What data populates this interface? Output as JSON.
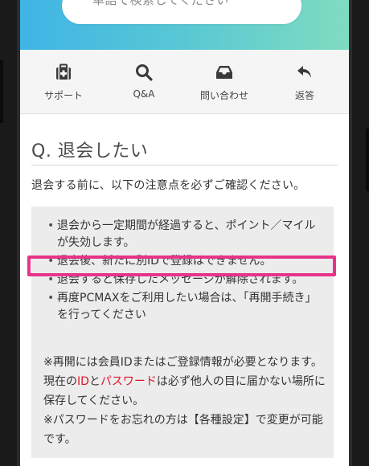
{
  "search": {
    "placeholder": "単語で検索してください"
  },
  "nav": {
    "items": [
      {
        "label": "サポート",
        "icon": "support-kit-icon"
      },
      {
        "label": "Q&A",
        "icon": "search-icon"
      },
      {
        "label": "問い合わせ",
        "icon": "inbox-icon"
      },
      {
        "label": "返答",
        "icon": "reply-icon"
      }
    ]
  },
  "page": {
    "title": "Q. 退会したい",
    "intro": "退会する前に、以下の注意点を必ずご確認ください。"
  },
  "notice": {
    "bullets": [
      "退会から一定期間が経過すると、ポイント／マイルが失効します。",
      "退会後、新たに別IDで登録はできません。",
      "退会すると保存したメッセージが解除されます。",
      "再度PCMAXをご利用したい場合は、「再開手続き」を行ってください"
    ],
    "note1_a": "※再開には会員IDまたはご登録情報が必要となります。現在の",
    "note1_id": "ID",
    "note1_b": "と",
    "note1_pw": "パスワード",
    "note1_c": "は必ず他人の目に届かない場所に保存してください。",
    "note2": "※パスワードをお忘れの方は【各種設定】で変更が可能です。"
  },
  "colors": {
    "highlight": "#e8338a",
    "emphasis": "#e0142a",
    "header_gradient_start": "#3fb5e6",
    "header_gradient_end": "#7fdcc0"
  }
}
